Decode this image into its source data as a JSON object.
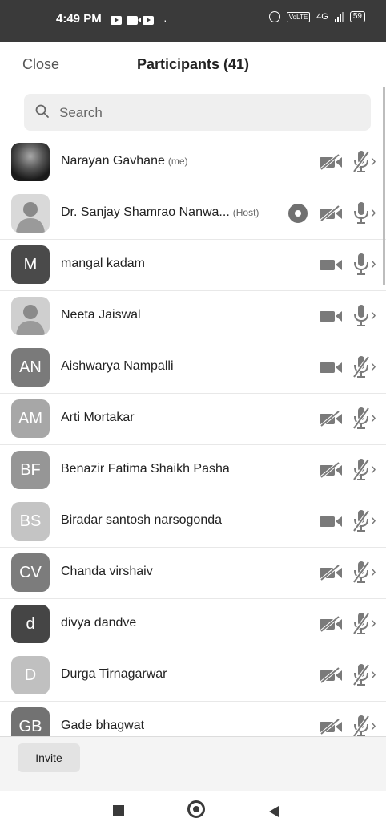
{
  "status_bar": {
    "time": "4:49 PM",
    "dot": "·",
    "volte": "VoLTE",
    "network": "4G",
    "battery": "59"
  },
  "header": {
    "close_label": "Close",
    "title": "Participants (41)"
  },
  "search": {
    "placeholder": "Search"
  },
  "participants": [
    {
      "name": "Narayan Gavhane",
      "tag": "(me)",
      "avatar_type": "photo1",
      "initials": "",
      "avatar_color": "#222222",
      "video_on": false,
      "mic_on": false,
      "host": false
    },
    {
      "name": "Dr. Sanjay Shamrao Nanwa...",
      "tag": "(Host)",
      "avatar_type": "photo2",
      "initials": "",
      "avatar_color": "#d9d9d9",
      "video_on": false,
      "mic_on": true,
      "host": true
    },
    {
      "name": "mangal kadam",
      "tag": "",
      "avatar_type": "initials",
      "initials": "M",
      "avatar_color": "#4a4a4a",
      "video_on": true,
      "mic_on": true,
      "host": false
    },
    {
      "name": "Neeta Jaiswal",
      "tag": "",
      "avatar_type": "photo3",
      "initials": "",
      "avatar_color": "#cfcfcf",
      "video_on": true,
      "mic_on": true,
      "host": false
    },
    {
      "name": "Aishwarya Nampalli",
      "tag": "",
      "avatar_type": "initials",
      "initials": "AN",
      "avatar_color": "#7a7a7a",
      "video_on": true,
      "mic_on": false,
      "host": false
    },
    {
      "name": "Arti Mortakar",
      "tag": "",
      "avatar_type": "initials",
      "initials": "AM",
      "avatar_color": "#a7a7a7",
      "video_on": false,
      "mic_on": false,
      "host": false
    },
    {
      "name": "Benazir Fatima Shaikh Pasha",
      "tag": "",
      "avatar_type": "initials",
      "initials": "BF",
      "avatar_color": "#969696",
      "video_on": false,
      "mic_on": false,
      "host": false
    },
    {
      "name": "Biradar santosh narsogonda",
      "tag": "",
      "avatar_type": "initials",
      "initials": "BS",
      "avatar_color": "#c4c4c4",
      "video_on": true,
      "mic_on": false,
      "host": false
    },
    {
      "name": "Chanda virshaiv",
      "tag": "",
      "avatar_type": "initials",
      "initials": "CV",
      "avatar_color": "#7c7c7c",
      "video_on": false,
      "mic_on": false,
      "host": false
    },
    {
      "name": "divya dandve",
      "tag": "",
      "avatar_type": "initials",
      "initials": "d",
      "avatar_color": "#454545",
      "video_on": false,
      "mic_on": false,
      "host": false
    },
    {
      "name": "Durga  Tirnagarwar",
      "tag": "",
      "avatar_type": "initials",
      "initials": "D",
      "avatar_color": "#c0c0c0",
      "video_on": false,
      "mic_on": false,
      "host": false
    },
    {
      "name": "Gade bhagwat",
      "tag": "",
      "avatar_type": "initials",
      "initials": "GB",
      "avatar_color": "#727272",
      "video_on": false,
      "mic_on": false,
      "host": false
    }
  ],
  "footer": {
    "invite_label": "Invite"
  },
  "colors": {
    "icon_gray": "#7a7a7a",
    "divider": "#e8e8e8",
    "search_bg": "#efefef"
  }
}
